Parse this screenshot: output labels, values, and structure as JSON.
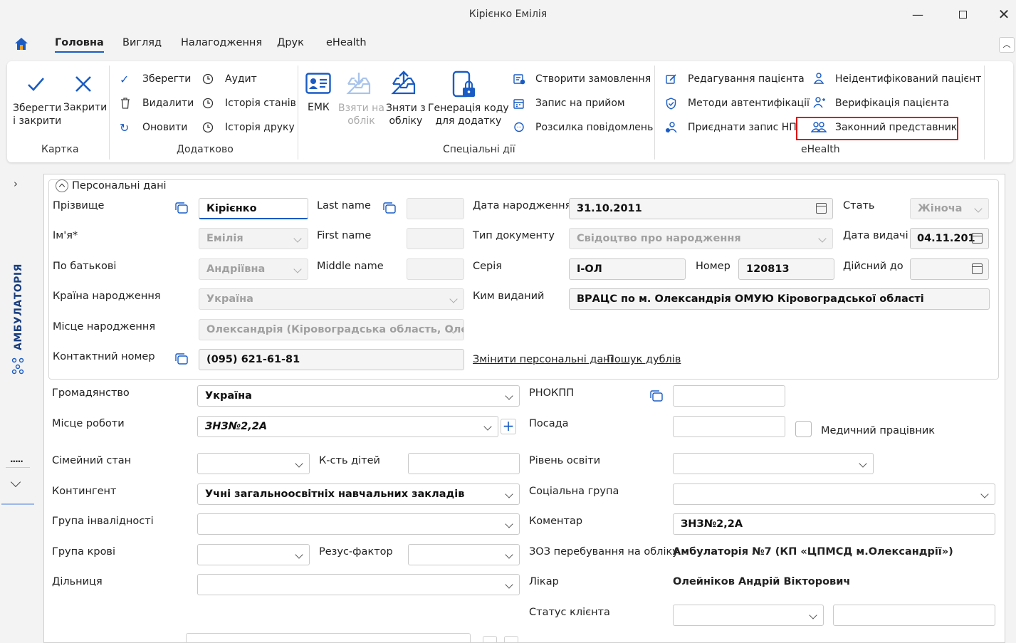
{
  "window": {
    "title": "Кірієнко Емілія"
  },
  "menu": {
    "tabs": [
      "Головна",
      "Вигляд",
      "Налагодження",
      "Друк",
      "eHealth"
    ]
  },
  "ribbon": {
    "kartka": {
      "title": "Картка",
      "save_close": "Зберегти\nі закрити",
      "close": "Закрити"
    },
    "dodatkovo": {
      "title": "Додатково",
      "items": [
        "Зберегти",
        "Видалити",
        "Оновити",
        "Аудит",
        "Історія станів",
        "Історія друку"
      ]
    },
    "special": {
      "title": "Спеціальні дії",
      "emk": "ЕМК",
      "take": "Взяти на\nоблік",
      "remove": "Зняти з\nобліку",
      "gen": "Генерація коду\nдля додатку",
      "items": [
        "Створити замовлення",
        "Запис на прийом",
        "Розсилка повідомлень"
      ]
    },
    "ehealth": {
      "title": "eHealth",
      "items": [
        "Редагування пацієнта",
        "Методи автентифікації",
        "Приєднати запис НП",
        "Неідентифікований пацієнт",
        "Верифікація пацієнта",
        "Законний представник"
      ]
    }
  },
  "side": {
    "label": "АМБУЛАТОРІЯ",
    "dots": "....."
  },
  "personal": {
    "group_title": "Персональні дані",
    "labels": {
      "surname": "Прізвище",
      "name": "Ім'я*",
      "patronymic": "По батькові",
      "country": "Країна народження",
      "birthplace": "Місце народження",
      "phone": "Контактний номер",
      "last_name": "Last name",
      "first_name": "First name",
      "middle_name": "Middle name",
      "birth_date": "Дата народження",
      "doc_type": "Тип документу",
      "series": "Серія",
      "issued_by": "Ким виданий",
      "number": "Номер",
      "sex": "Стать",
      "issue_date": "Дата видачі",
      "valid_to": "Дійсний до"
    },
    "values": {
      "surname": "Кірієнко",
      "name": "Емілія",
      "patronymic": "Андріївна",
      "country": "Україна",
      "birthplace": "Олександрія (Кіровоградська область, Олеке",
      "phone": "(095) 621-61-81",
      "birth_date": "31.10.2011",
      "doc_type": "Свідоцтво про народження",
      "series": "І-ОЛ",
      "number": "120813",
      "issued_by": "ВРАЦС по м. Олександрія ОМУЮ Кіровоградської області",
      "sex": "Жіноча",
      "issue_date": "04.11.201"
    },
    "links": {
      "change": "Змінити персональні дані",
      "dups": "Пошук дублів"
    }
  },
  "details": {
    "labels": {
      "citizenship": "Громадянство",
      "work": "Місце роботи",
      "family": "Сімейний стан",
      "children": "К-сть дітей",
      "contingent": "Контингент",
      "disability": "Група інвалідності",
      "blood": "Група крові",
      "rh": "Резус-фактор",
      "district": "Дільниця",
      "rnokpp": "РНОКПП",
      "position": "Посада",
      "medic": "Медичний працівник",
      "education": "Рівень освіти",
      "social": "Соціальна група",
      "comment": "Коментар",
      "zoz": "ЗОЗ перебування на обліку",
      "doctor": "Лікар",
      "status": "Статус клієнта"
    },
    "values": {
      "citizenship": "Україна",
      "work": "ЗНЗ№2,2А",
      "contingent": "Учні загальноосвітніх навчальних закладів",
      "comment": "ЗНЗ№2,2А",
      "zoz": "Амбулаторія №7 (КП «ЦПМСД м.Олександрії»)",
      "doctor": "Олейніков Андрій Вікторович"
    }
  }
}
